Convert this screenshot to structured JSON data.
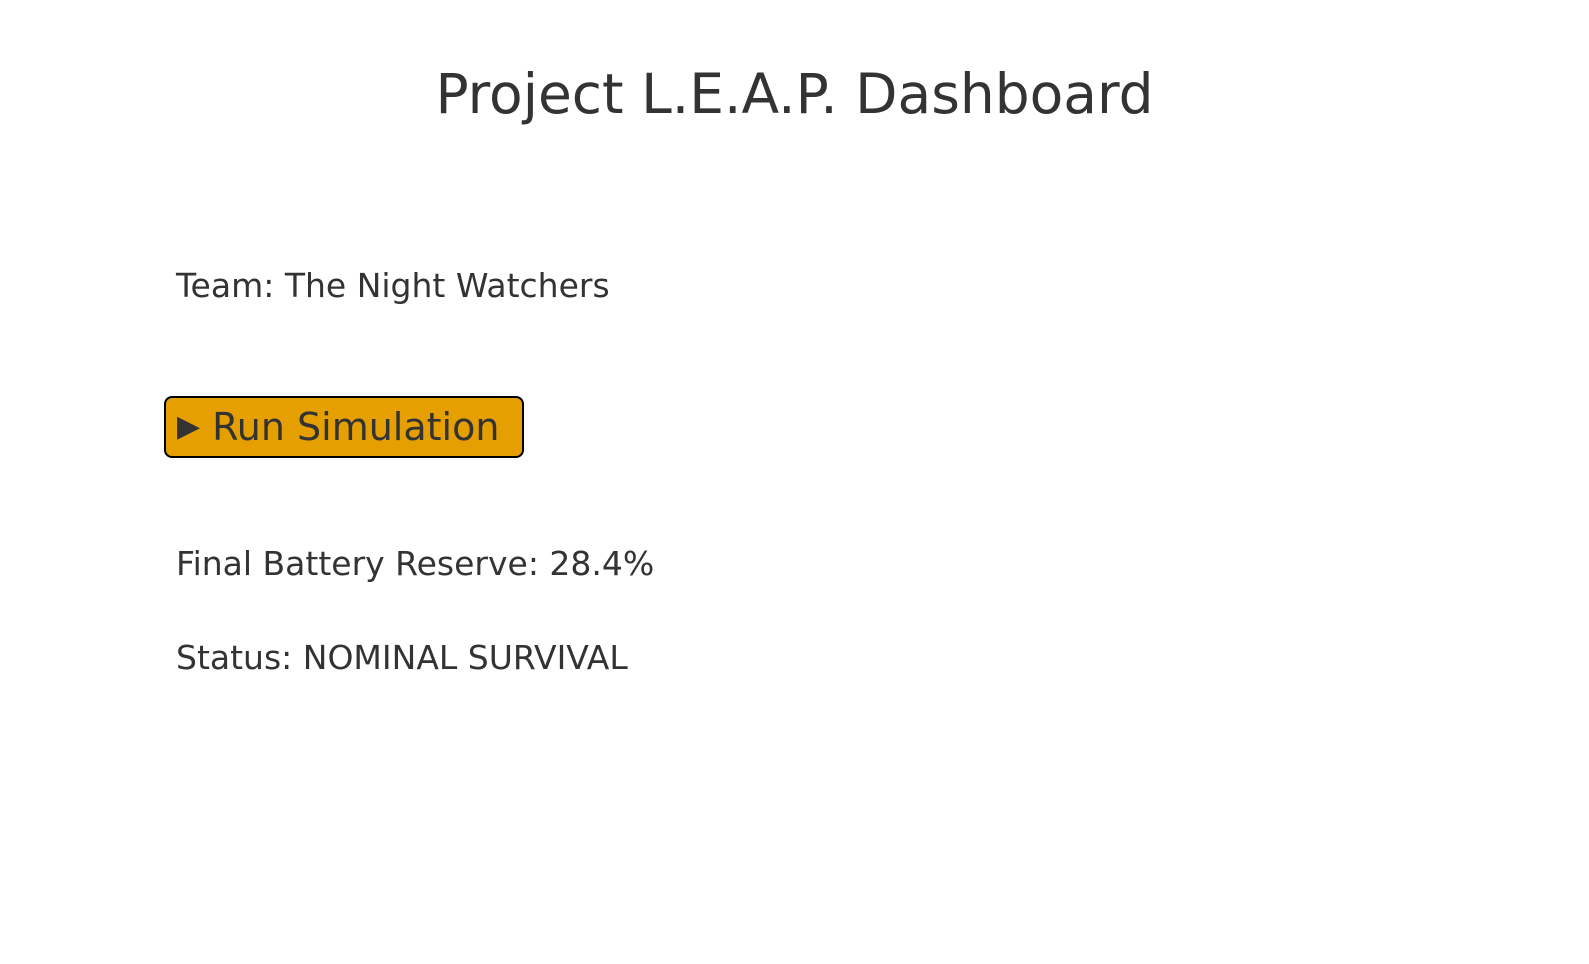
{
  "header": {
    "title": "Project L.E.A.P. Dashboard"
  },
  "team": {
    "label": "Team: The Night Watchers"
  },
  "actions": {
    "run_icon": "play-icon",
    "run_glyph": "▶",
    "run_label": "Run Simulation",
    "run_color": "#e69f00"
  },
  "results": {
    "battery_label": "Final Battery Reserve: 28.4%",
    "status_label": "Status: NOMINAL SURVIVAL"
  }
}
